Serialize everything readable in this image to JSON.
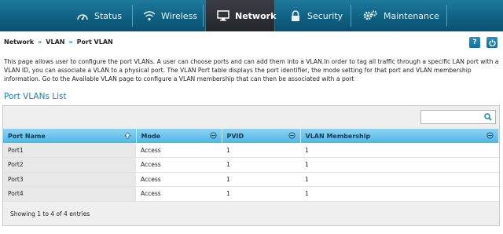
{
  "nav": {
    "items": [
      {
        "label": "Status",
        "icon": "gauge-icon"
      },
      {
        "label": "Wireless",
        "icon": "wifi-icon"
      },
      {
        "label": "Network",
        "icon": "monitor-icon",
        "active": true
      },
      {
        "label": "Security",
        "icon": "lock-icon"
      },
      {
        "label": "Maintenance",
        "icon": "gears-icon"
      }
    ]
  },
  "breadcrumb": {
    "items": [
      "Network",
      "VLAN",
      "Port VLAN"
    ],
    "separator": "»"
  },
  "buttons": {
    "help": "?",
    "logout": "⏻"
  },
  "description": "This page allows user to configure the port VLANs. A user can choose ports and can add them into a VLAN.In order to tag all traffic through a specific LAN port with a VLAN ID, you can associate a VLAN to a physical port. The VLAN Port table displays the port identifier, the mode setting for that port and VLAN membership information. Go to the Available VLAN page to configure a VLAN membership that can then be associated with a port",
  "section_title": "Port VLANs List",
  "search": {
    "value": "",
    "placeholder": ""
  },
  "table": {
    "columns": [
      "Port Name",
      "Mode",
      "PVID",
      "VLAN Membership"
    ],
    "rows": [
      [
        "Port1",
        "Access",
        "1",
        "1"
      ],
      [
        "Port2",
        "Access",
        "1",
        "1"
      ],
      [
        "Port3",
        "Access",
        "1",
        "1"
      ],
      [
        "Port4",
        "Access",
        "1",
        "1"
      ]
    ]
  },
  "footer": "Showing 1 to 4 of 4 entries",
  "colors": {
    "nav_bg": "#0f5f80",
    "nav_active": "#2a2f34",
    "accent": "#1a7fae",
    "header_row": "#4db7e6"
  }
}
